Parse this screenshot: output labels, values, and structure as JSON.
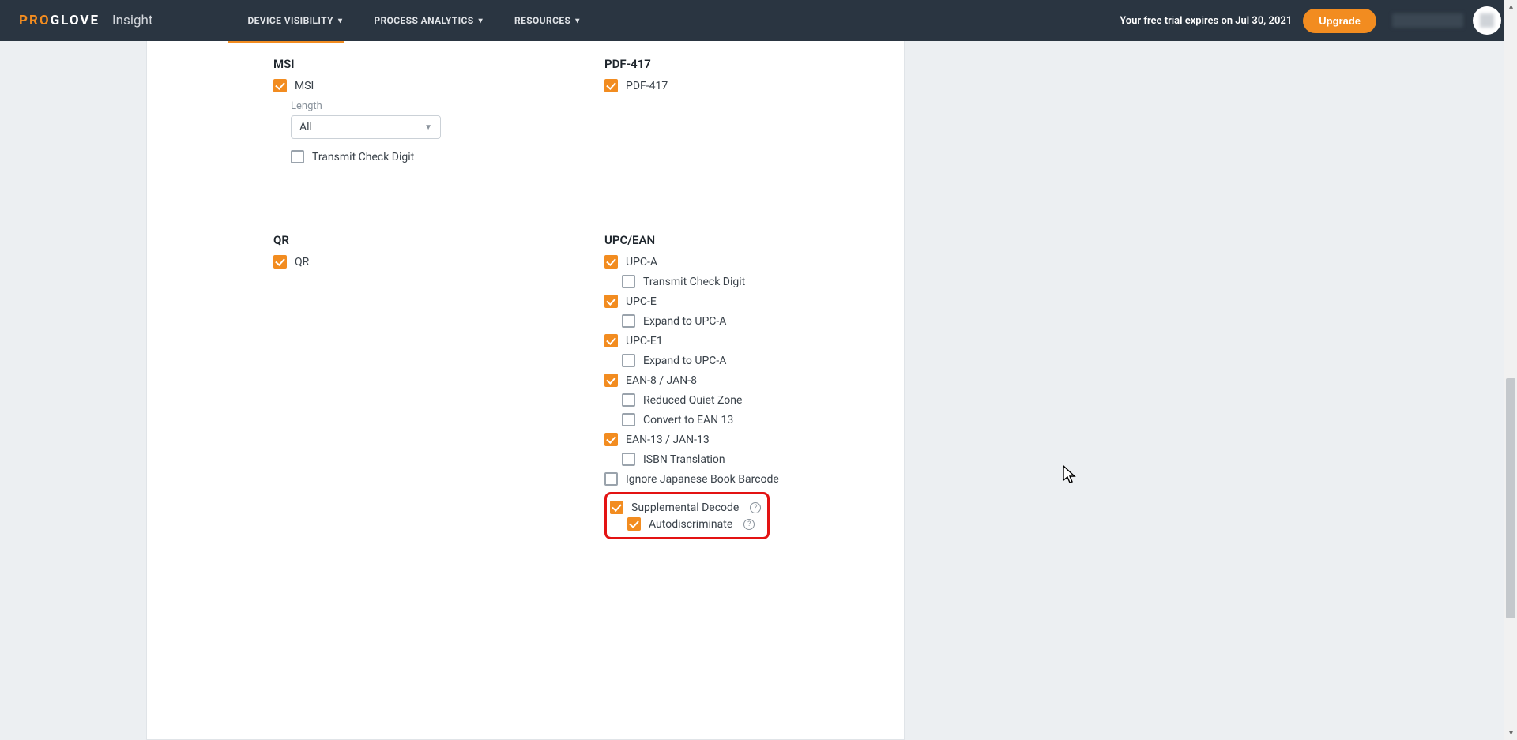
{
  "brand": {
    "pro": "PRO",
    "glove": "GLOVE",
    "product": "Insight"
  },
  "nav": {
    "items": [
      "DEVICE VISIBILITY",
      "PROCESS ANALYTICS",
      "RESOURCES"
    ]
  },
  "trial": {
    "text": "Your free trial expires on Jul 30, 2021",
    "upgrade": "Upgrade"
  },
  "sections": {
    "msi": {
      "title": "MSI",
      "opt_msi": "MSI",
      "length_label": "Length",
      "length_value": "All",
      "transmit_check_digit": "Transmit Check Digit"
    },
    "pdf417": {
      "title": "PDF-417",
      "opt": "PDF-417"
    },
    "qr": {
      "title": "QR",
      "opt": "QR"
    },
    "upcean": {
      "title": "UPC/EAN",
      "upc_a": "UPC-A",
      "upc_a_transmit": "Transmit Check Digit",
      "upc_e": "UPC-E",
      "upc_e_expand": "Expand to UPC-A",
      "upc_e1": "UPC-E1",
      "upc_e1_expand": "Expand to UPC-A",
      "ean8": "EAN-8 / JAN-8",
      "ean8_rqz": "Reduced Quiet Zone",
      "ean8_conv": "Convert to EAN 13",
      "ean13": "EAN-13 / JAN-13",
      "ean13_isbn": "ISBN Translation",
      "ignore_jp": "Ignore Japanese Book Barcode",
      "supp_decode": "Supplemental Decode",
      "autodisc": "Autodiscriminate"
    }
  }
}
